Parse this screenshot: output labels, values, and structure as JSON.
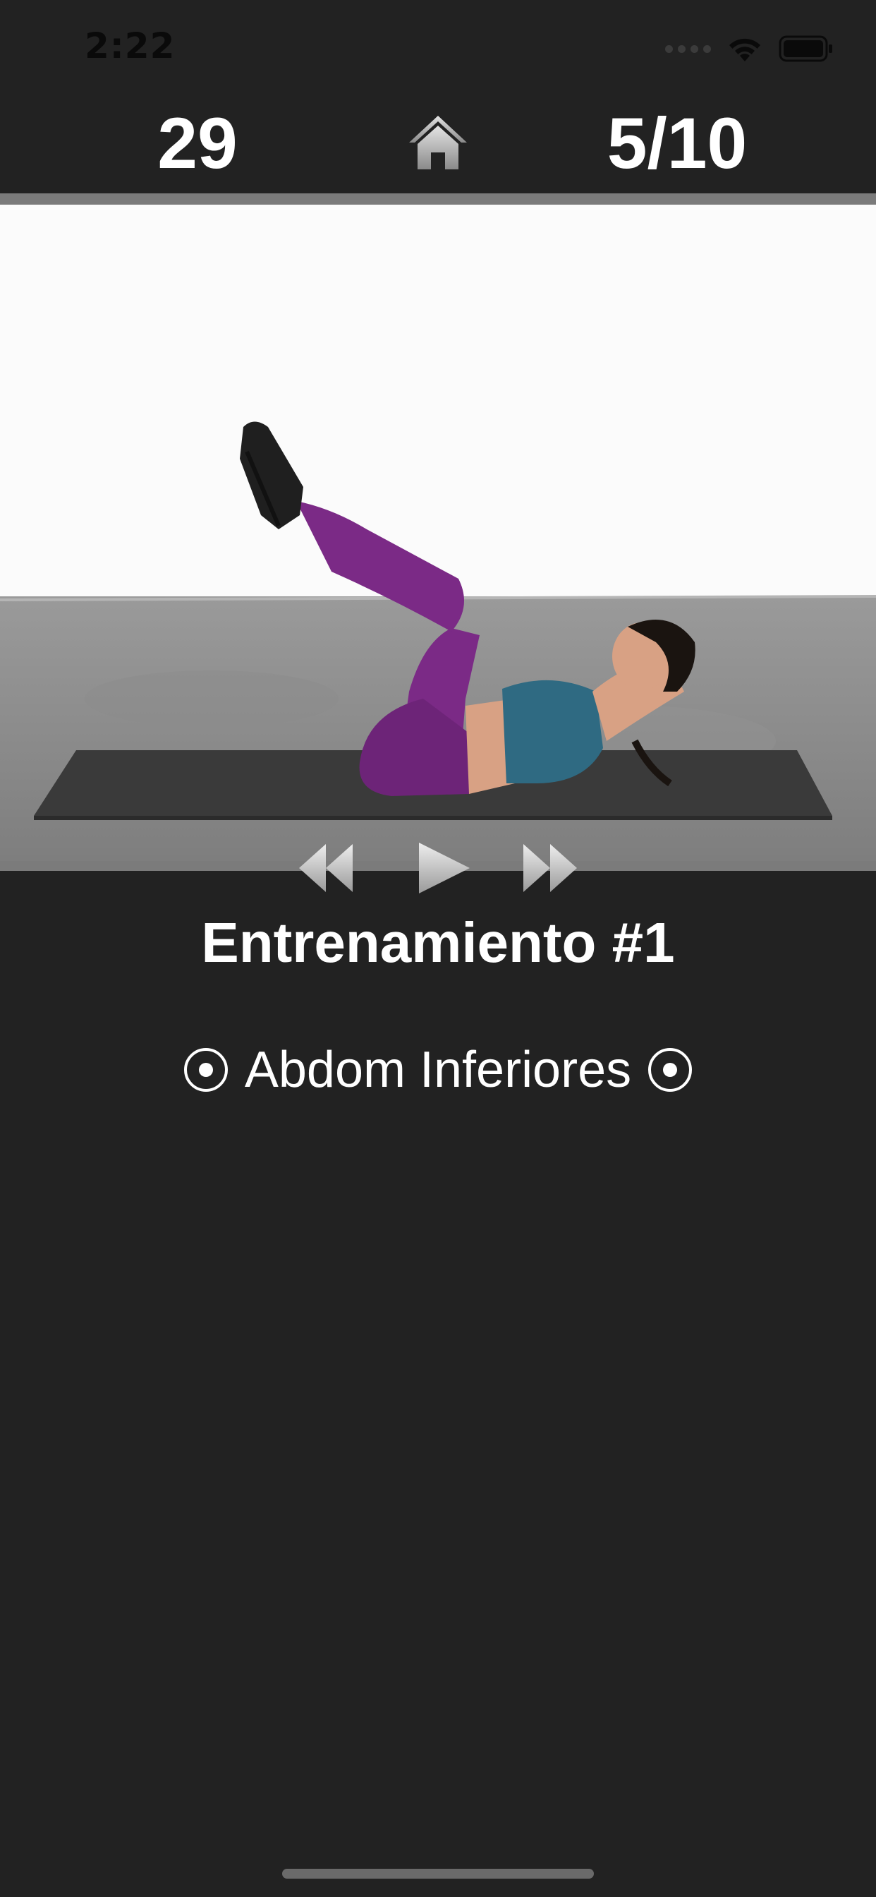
{
  "status_bar": {
    "time": "2:22",
    "icons": [
      "signal-dots-icon",
      "wifi-icon",
      "battery-icon"
    ]
  },
  "header": {
    "timer": "29",
    "home_icon": "home-icon",
    "progress": "5/10"
  },
  "video": {
    "subject": "woman performing crunch exercise on a yoga mat"
  },
  "controls": {
    "icons": [
      "rewind-icon",
      "play-icon",
      "fast-forward-icon"
    ]
  },
  "workout": {
    "title": "Entrenamiento #1",
    "exercise": "Abdom Inferiores"
  },
  "colors": {
    "background": "#222222",
    "divider": "#7b7b7b",
    "text": "#ffffff",
    "legging": "#7b2a86",
    "top": "#2f6a82"
  }
}
